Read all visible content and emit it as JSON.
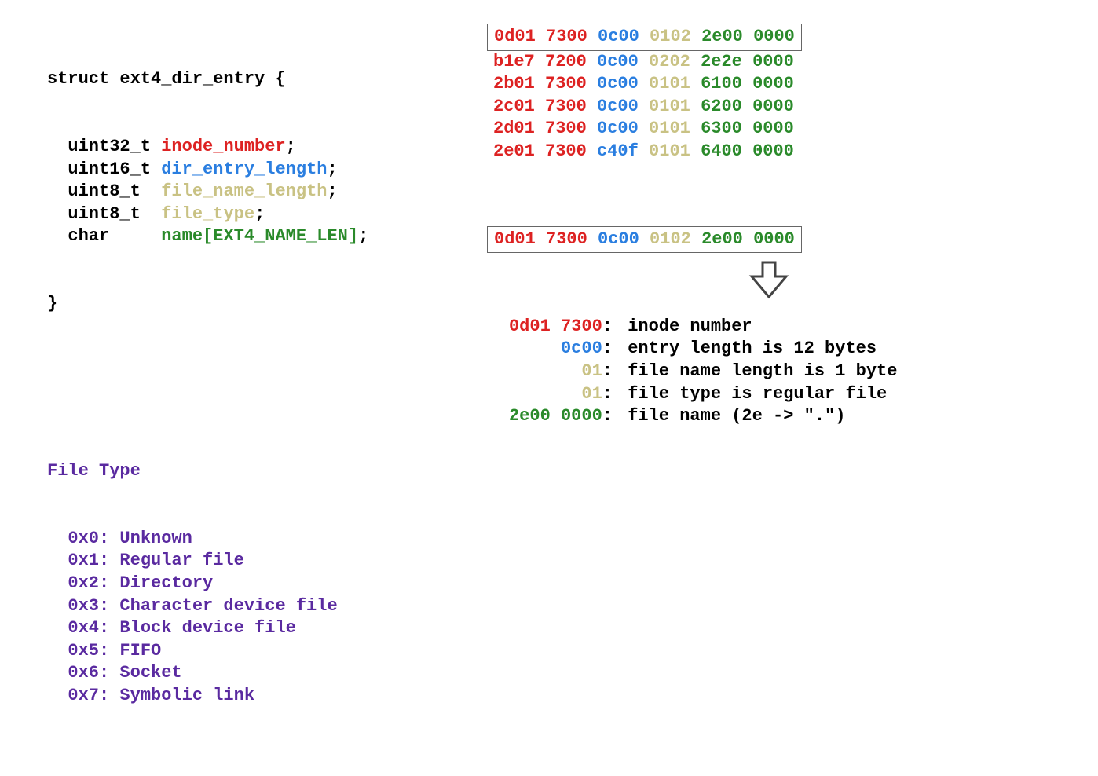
{
  "struct": {
    "decl_open": "struct ext4_dir_entry {",
    "fields": [
      {
        "type": "uint32_t",
        "name": "inode_number",
        "suffix": ";",
        "color": "c-red"
      },
      {
        "type": "uint16_t",
        "name": "dir_entry_length",
        "suffix": ";",
        "color": "c-blue"
      },
      {
        "type": "uint8_t",
        "name": "file_name_length",
        "suffix": ";",
        "color": "c-khaki"
      },
      {
        "type": "uint8_t",
        "name": "file_type",
        "suffix": ";",
        "color": "c-khaki"
      },
      {
        "type": "char",
        "name": "name[EXT4_NAME_LEN]",
        "suffix": ";",
        "color": "c-green"
      }
    ],
    "decl_close": "}"
  },
  "file_type": {
    "title": "File Type",
    "entries": [
      {
        "code": "0x0",
        "label": "Unknown"
      },
      {
        "code": "0x1",
        "label": "Regular file"
      },
      {
        "code": "0x2",
        "label": "Directory"
      },
      {
        "code": "0x3",
        "label": "Character device file"
      },
      {
        "code": "0x4",
        "label": "Block device file"
      },
      {
        "code": "0x5",
        "label": "FIFO"
      },
      {
        "code": "0x6",
        "label": "Socket"
      },
      {
        "code": "0x7",
        "label": "Symbolic link"
      }
    ]
  },
  "hex_table": {
    "rows": [
      {
        "inode_a": "0d01",
        "inode_b": "7300",
        "len": "0c00",
        "nl_ft": "0102",
        "name_a": "2e00",
        "name_b": "0000"
      },
      {
        "inode_a": "b1e7",
        "inode_b": "7200",
        "len": "0c00",
        "nl_ft": "0202",
        "name_a": "2e2e",
        "name_b": "0000"
      },
      {
        "inode_a": "2b01",
        "inode_b": "7300",
        "len": "0c00",
        "nl_ft": "0101",
        "name_a": "6100",
        "name_b": "0000"
      },
      {
        "inode_a": "2c01",
        "inode_b": "7300",
        "len": "0c00",
        "nl_ft": "0101",
        "name_a": "6200",
        "name_b": "0000"
      },
      {
        "inode_a": "2d01",
        "inode_b": "7300",
        "len": "0c00",
        "nl_ft": "0101",
        "name_a": "6300",
        "name_b": "0000"
      },
      {
        "inode_a": "2e01",
        "inode_b": "7300",
        "len": "c40f",
        "nl_ft": "0101",
        "name_a": "6400",
        "name_b": "0000"
      }
    ]
  },
  "breakdown": {
    "header": {
      "inode_a": "0d01",
      "inode_b": "7300",
      "len": "0c00",
      "nl_ft": "0102",
      "name_a": "2e00",
      "name_b": "0000"
    },
    "rows": [
      {
        "key_html": [
          {
            "t": "0d01 7300",
            "c": "c-red"
          }
        ],
        "desc": "inode number"
      },
      {
        "key_html": [
          {
            "t": "0c00",
            "c": "c-blue"
          }
        ],
        "desc": "entry length is 12 bytes"
      },
      {
        "key_html": [
          {
            "t": "01",
            "c": "c-khaki"
          }
        ],
        "desc": "file name length is 1 byte"
      },
      {
        "key_html": [
          {
            "t": "01",
            "c": "c-khaki"
          }
        ],
        "desc": "file type is regular file"
      },
      {
        "key_html": [
          {
            "t": "2e00 0000",
            "c": "c-green"
          }
        ],
        "desc": "file name (2e -> \".\")"
      }
    ]
  },
  "colors": {
    "red": "#d22",
    "blue": "#2a7ee0",
    "khaki": "#c9c284",
    "green": "#2a8a2a",
    "purple": "#5a2aa0"
  }
}
